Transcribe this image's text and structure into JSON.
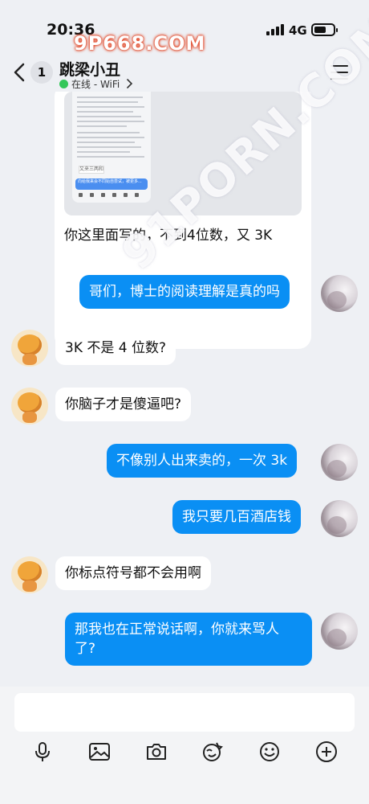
{
  "status_bar": {
    "time": "20:36",
    "network": "4G"
  },
  "watermarks": {
    "top": "9P668.COM",
    "diagonal": "91PORN.COM"
  },
  "header": {
    "unread_count": "1",
    "contact_name": "跳梁小丑",
    "presence": "在线 - WiFi"
  },
  "messages": [
    {
      "sender": "other",
      "type": "quote_with_image",
      "text": "你这里面写的，不到4位数，又 3K"
    },
    {
      "sender": "self",
      "text": "哥们，博士的阅读理解是真的吗"
    },
    {
      "sender": "other",
      "text": "3K 不是 4 位数?"
    },
    {
      "sender": "other",
      "text": "你脑子才是傻逼吧?"
    },
    {
      "sender": "self",
      "text": "不像别人出来卖的，一次 3k"
    },
    {
      "sender": "self",
      "text": "我只要几百酒店钱"
    },
    {
      "sender": "other",
      "text": "你标点符号都不会用啊"
    },
    {
      "sender": "self",
      "text_line1": "那我也在正常说话啊，你就来骂人",
      "text_line2": "了?"
    }
  ],
  "quoted_image": {
    "tag_text": "又来三两和",
    "blue_text": "向给我来会不同始自尝试，被更多..."
  },
  "composer": {
    "placeholder": "",
    "tools": [
      "microphone-icon",
      "image-icon",
      "camera-icon",
      "sticker-icon",
      "emoji-icon",
      "plus-icon"
    ]
  },
  "colors": {
    "self_bubble": "#0a8ff4",
    "other_bubble": "#ffffff",
    "background": "#eef0f4",
    "online": "#34c759"
  }
}
